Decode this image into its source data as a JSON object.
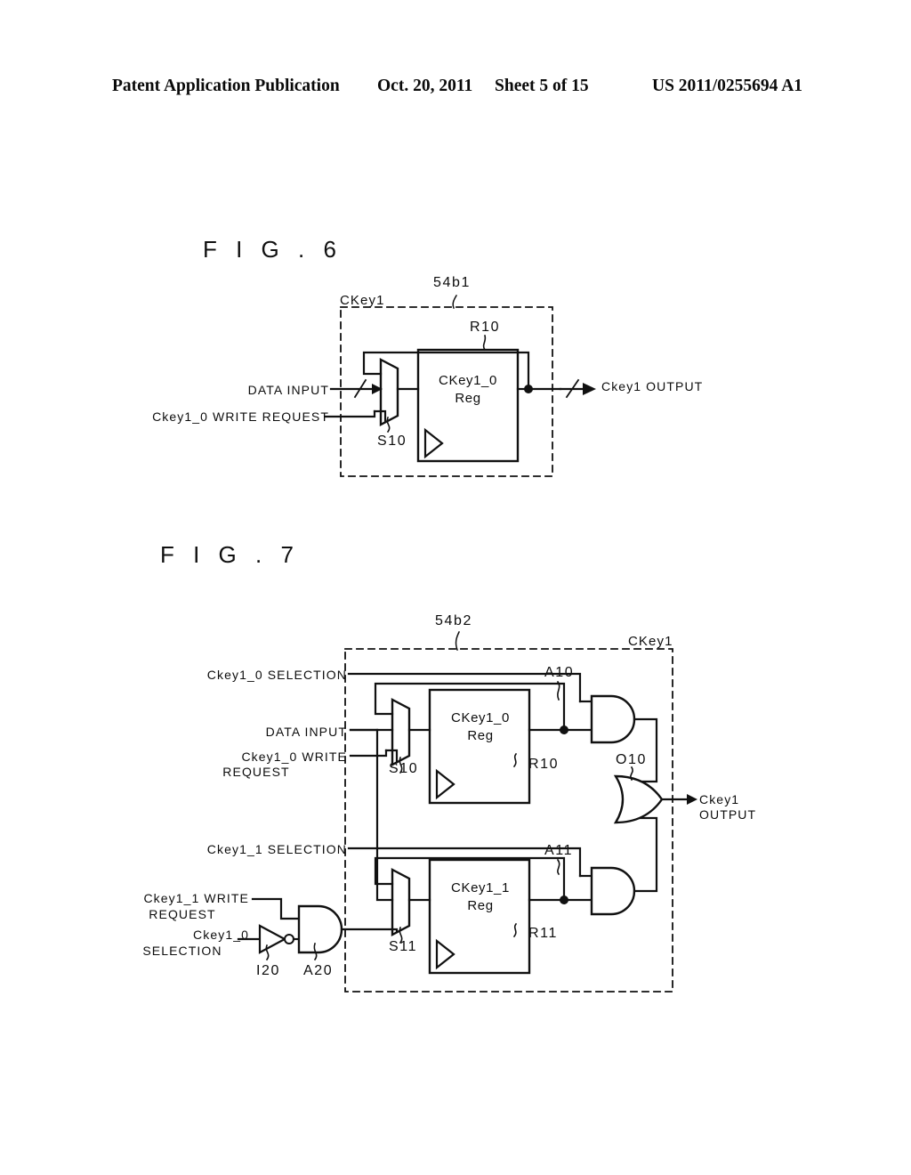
{
  "header": {
    "title": "Patent Application Publication",
    "date": "Oct. 20, 2011",
    "sheet": "Sheet 5 of 15",
    "number": "US 2011/0255694 A1"
  },
  "figures": [
    {
      "title": "F I G . 6",
      "enclosure_label": "CKey1",
      "callout": "54b1",
      "register": {
        "line1": "CKey1_0",
        "line2": "Reg",
        "ref": "R10"
      },
      "mux_ref": "S10",
      "inputs": [
        {
          "label": "DATA INPUT"
        },
        {
          "label": "Ckey1_0 WRITE REQUEST"
        }
      ],
      "outputs": [
        {
          "label": "Ckey1 OUTPUT"
        }
      ]
    },
    {
      "title": "F I G . 7",
      "enclosure_label": "CKey1",
      "callout": "54b2",
      "registers": [
        {
          "line1": "CKey1_0",
          "line2": "Reg",
          "ref": "R10"
        },
        {
          "line1": "CKey1_1",
          "line2": "Reg",
          "ref": "R11"
        }
      ],
      "gates": [
        {
          "ref": "A10",
          "type": "and-gate"
        },
        {
          "ref": "A11",
          "type": "and-gate"
        },
        {
          "ref": "O10",
          "type": "or-gate"
        },
        {
          "ref": "A20",
          "type": "and-gate"
        },
        {
          "ref": "I20",
          "type": "inverter"
        }
      ],
      "mux_refs": [
        "S10",
        "S11"
      ],
      "inputs": [
        {
          "label": "Ckey1_0 SELECTION"
        },
        {
          "label": "DATA INPUT"
        },
        {
          "label": "Ckey1_0 WRITE",
          "label2": "REQUEST"
        },
        {
          "label": "Ckey1_1 SELECTION"
        },
        {
          "label": "Ckey1_1 WRITE",
          "label2": "REQUEST"
        },
        {
          "label": "Ckey1_0",
          "label2": "SELECTION"
        }
      ],
      "outputs": [
        {
          "label": "Ckey1",
          "label2": "OUTPUT"
        }
      ]
    }
  ],
  "colors": {
    "ink": "#0d0d0d",
    "paper": "#ffffff"
  }
}
